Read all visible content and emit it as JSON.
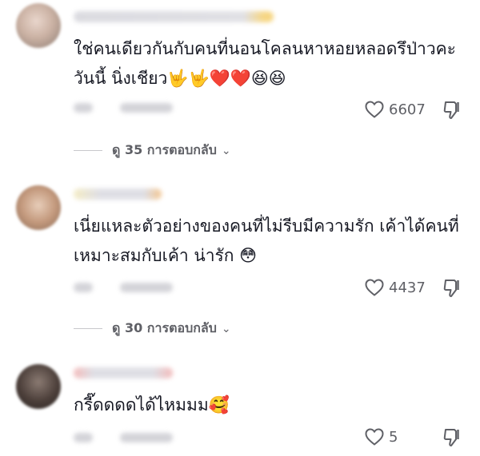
{
  "comments": [
    {
      "text": "ใช่คนเดียวกันกับคนที่นอนโคลนหาหอยหลอดรึป่าวคะ วันนี้ นิ่งเชียว🤟🤟❤️❤️😆😆",
      "likes": "6607",
      "replies_label": "ดู 35 การตอบกลับ"
    },
    {
      "text": "เนี่ยแหละตัวอย่างของคนที่ไม่รีบมีความรัก เค้าได้คนที่เหมาะสมกับเค้า น่ารัก 😳",
      "likes": "4437",
      "replies_label": "ดู 30 การตอบกลับ"
    },
    {
      "text": "กรี๊ดดดดได้ไหมมม🥰",
      "likes": "5"
    }
  ],
  "icons": {
    "like": "heart-outline-icon",
    "dislike": "thumbs-down-icon"
  },
  "colors": {
    "text": "#161823",
    "muted": "#5f6066"
  }
}
